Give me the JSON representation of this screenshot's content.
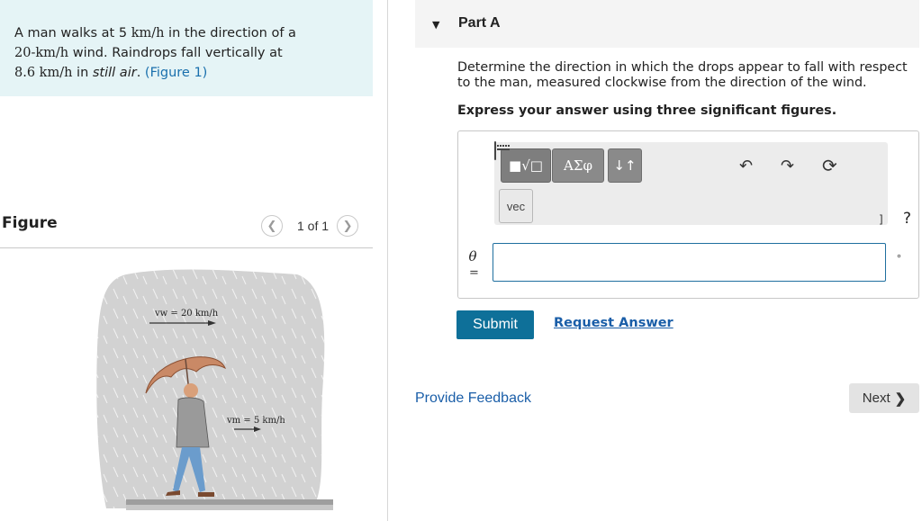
{
  "problem": {
    "text_1": "A man walks at 5 ",
    "speed_man": "km/h",
    "text_2": " in the direction of a",
    "wind_value": "20-km/h",
    "text_3": " wind. Raindrops fall vertically at",
    "drop_speed": "8.6  km/h",
    "text_4": " in ",
    "still_air": "still air",
    "text_5": ". ",
    "figure_link": "(Figure 1)"
  },
  "figure": {
    "heading": "Figure",
    "pager": "1 of 1",
    "wind_label": "vw = 20 km/h",
    "man_label": "vm = 5 km/h"
  },
  "part": {
    "title": "Part A",
    "question": "Determine the direction in which the drops appear to fall with respect to the man, measured clockwise from the direction of the wind.",
    "instruction": "Express your answer using three significant figures."
  },
  "answer": {
    "variable": "θ",
    "equals": "=",
    "value": "",
    "unit": "∘"
  },
  "toolbar": {
    "template": "■√□",
    "greek": "ΑΣφ",
    "arrows": "↓↑",
    "vec": "vec",
    "units": "]",
    "help": "?"
  },
  "actions": {
    "submit": "Submit",
    "request_answer": "Request Answer",
    "provide_feedback": "Provide Feedback",
    "next": "Next"
  },
  "icons": [
    "collapse-triangle-icon",
    "undo-icon",
    "redo-icon",
    "reset-icon",
    "keyboard-icon",
    "chevron-left-icon",
    "chevron-right-icon"
  ],
  "colors": {
    "problem_bg": "#e5f4f6",
    "link": "#1a5ea8",
    "submit_bg": "#0e7099",
    "input_border": "#1f6f9f"
  }
}
